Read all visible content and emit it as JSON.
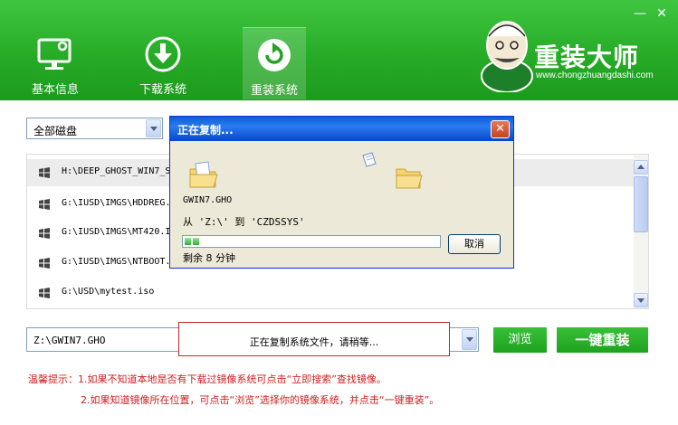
{
  "window": {
    "minimize_icon": "minimize-icon",
    "close_icon": "close-icon",
    "minimize_glyph": "—",
    "close_glyph": "✕"
  },
  "nav": [
    {
      "label": "基本信息",
      "icon": "monitor-gear-icon"
    },
    {
      "label": "下载系统",
      "icon": "download-arrow-icon"
    },
    {
      "label": "重装系统",
      "icon": "restore-arrow-icon",
      "active": true
    }
  ],
  "brand": {
    "title": "重装大师",
    "url": "www.chongzhuangdashi.com"
  },
  "disk_filter": {
    "selected": "全部磁盘"
  },
  "file_list": {
    "rows": [
      {
        "path": "H:\\DEEP_GHOST_WIN7_S",
        "selected": true
      },
      {
        "path": "G:\\IUSD\\IMGS\\HDDREG."
      },
      {
        "path": "G:\\IUSD\\IMGS\\MT420.I"
      },
      {
        "path": "G:\\IUSD\\IMGS\\NTBOOT."
      },
      {
        "path": "G:\\USD\\mytest.iso"
      }
    ]
  },
  "copy_dialog": {
    "title": "正在复制...",
    "close_glyph": "✕",
    "file_name": "GWIN7.GHO",
    "from_to": "从 'Z:\\' 到 'CZDSSYS'",
    "progress": 0.06,
    "progress_blocks": 2,
    "cancel_label": "取消",
    "remaining": "剩余 8 分钟"
  },
  "image_path": {
    "value": "Z:\\GWIN7.GHO"
  },
  "status_message": "正在复制系统文件，请稍等...",
  "buttons": {
    "browse": "浏览",
    "reinstall": "一键重装"
  },
  "tips": {
    "line1": "温馨提示：1.如果不知道本地是否有下载过镜像系统可点击“立即搜索”查找镜像。",
    "line2": "2.如果知道镜像所在位置，可点击“浏览”选择你的镜像系统，并点击“一键重装”。"
  },
  "colors": {
    "header_green": "#27ac27",
    "button_green": "#1fa21f",
    "tip_red": "#d01f1f",
    "dialog_blue": "#0a5fd8"
  }
}
